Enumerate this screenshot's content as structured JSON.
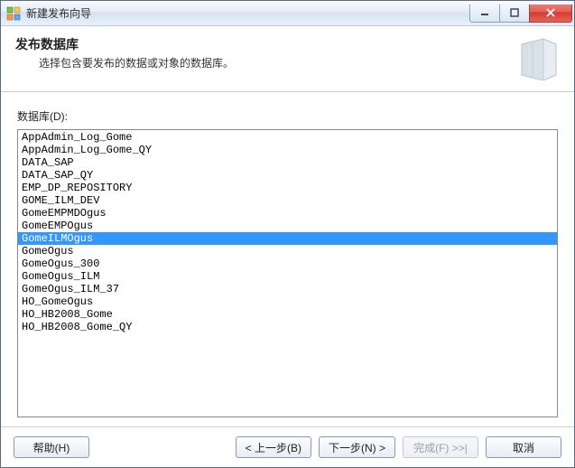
{
  "window": {
    "title": "新建发布向导"
  },
  "header": {
    "title": "发布数据库",
    "subtitle": "选择包含要发布的数据或对象的数据库。"
  },
  "body": {
    "list_label": "数据库(D):",
    "selected_index": 8,
    "items": [
      "AppAdmin_Log_Gome",
      "AppAdmin_Log_Gome_QY",
      "DATA_SAP",
      "DATA_SAP_QY",
      "EMP_DP_REPOSITORY",
      "GOME_ILM_DEV",
      "GomeEMPMDOgus",
      "GomeEMPOgus",
      "GomeILMOgus",
      "GomeOgus",
      "GomeOgus_300",
      "GomeOgus_ILM",
      "GomeOgus_ILM_37",
      "HO_GomeOgus",
      "HO_HB2008_Gome",
      "HO_HB2008_Gome_QY"
    ]
  },
  "footer": {
    "help": "帮助(H)",
    "back": "< 上一步(B)",
    "next": "下一步(N) >",
    "finish": "完成(F) >>|",
    "cancel": "取消"
  }
}
